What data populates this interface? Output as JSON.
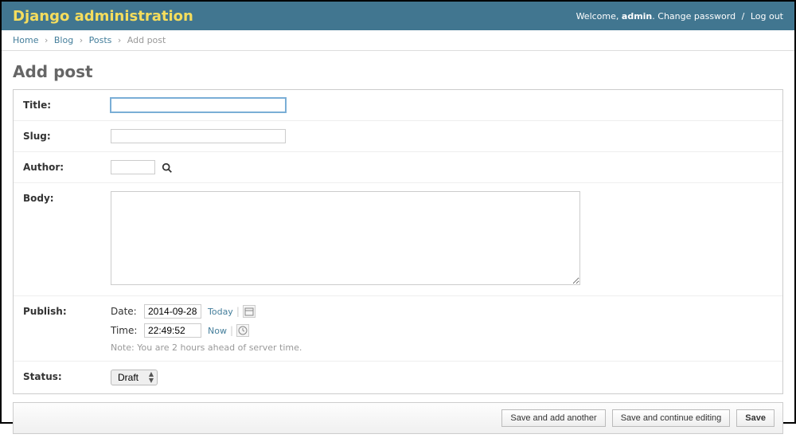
{
  "header": {
    "branding": "Django administration",
    "welcome_prefix": "Welcome, ",
    "username": "admin",
    "welcome_suffix": ".",
    "change_password": "Change password",
    "logout": "Log out"
  },
  "breadcrumb": {
    "home": "Home",
    "app": "Blog",
    "model": "Posts",
    "current": "Add post"
  },
  "page": {
    "title": "Add post"
  },
  "form": {
    "title": {
      "label": "Title:",
      "value": ""
    },
    "slug": {
      "label": "Slug:",
      "value": ""
    },
    "author": {
      "label": "Author:",
      "value": ""
    },
    "body": {
      "label": "Body:",
      "value": ""
    },
    "publish": {
      "label": "Publish:",
      "date_label": "Date:",
      "date_value": "2014-09-28",
      "today": "Today",
      "time_label": "Time:",
      "time_value": "22:49:52",
      "now": "Now",
      "tz_note": "Note: You are 2 hours ahead of server time."
    },
    "status": {
      "label": "Status:",
      "selected": "Draft"
    }
  },
  "actions": {
    "save_add": "Save and add another",
    "save_continue": "Save and continue editing",
    "save": "Save"
  }
}
